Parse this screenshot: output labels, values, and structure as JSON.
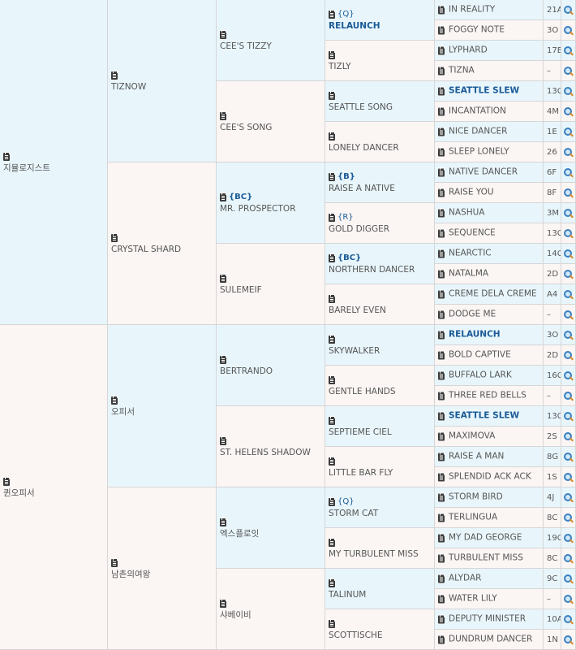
{
  "pedigree": {
    "gen1": [
      {
        "name": "지뮬로지스트",
        "side": "sire"
      },
      {
        "name": "퀸오피서",
        "side": "dam"
      }
    ],
    "gen2": [
      {
        "name": "TIZNOW",
        "side": "sire"
      },
      {
        "name": "CRYSTAL SHARD",
        "side": "dam"
      },
      {
        "name": "오피서",
        "side": "sire"
      },
      {
        "name": "남촌의여왕",
        "side": "dam"
      }
    ],
    "gen3": [
      {
        "name": "CEE'S TIZZY",
        "side": "sire"
      },
      {
        "name": "CEE'S SONG",
        "side": "dam"
      },
      {
        "name": "MR. PROSPECTOR",
        "side": "sire",
        "badge": "{BC}"
      },
      {
        "name": "SULEMEIF",
        "side": "dam"
      },
      {
        "name": "BERTRANDO",
        "side": "sire"
      },
      {
        "name": "ST. HELENS SHADOW",
        "side": "dam"
      },
      {
        "name": "엑스플로잇",
        "side": "sire"
      },
      {
        "name": "샤베이비",
        "side": "dam"
      }
    ],
    "gen4": [
      {
        "name": "RELAUNCH",
        "side": "sire",
        "badge": "{Q}",
        "bold": true
      },
      {
        "name": "TIZLY",
        "side": "dam"
      },
      {
        "name": "SEATTLE SONG",
        "side": "sire"
      },
      {
        "name": "LONELY DANCER",
        "side": "dam"
      },
      {
        "name": "RAISE A NATIVE",
        "side": "sire",
        "badge": "{B}"
      },
      {
        "name": "GOLD DIGGER",
        "side": "dam",
        "badge": "{R}"
      },
      {
        "name": "NORTHERN DANCER",
        "side": "sire",
        "badge": "{BC}"
      },
      {
        "name": "BARELY EVEN",
        "side": "dam"
      },
      {
        "name": "SKYWALKER",
        "side": "sire"
      },
      {
        "name": "GENTLE HANDS",
        "side": "dam"
      },
      {
        "name": "SEPTIEME CIEL",
        "side": "sire"
      },
      {
        "name": "LITTLE BAR FLY",
        "side": "dam"
      },
      {
        "name": "STORM CAT",
        "side": "sire",
        "badge": "{Q}"
      },
      {
        "name": "MY TURBULENT MISS",
        "side": "dam"
      },
      {
        "name": "TALINUM",
        "side": "sire"
      },
      {
        "name": "SCOTTISCHE",
        "side": "dam"
      }
    ],
    "gen5": [
      {
        "name": "IN REALITY",
        "code": "21A",
        "side": "sire"
      },
      {
        "name": "FOGGY NOTE",
        "code": "3O",
        "side": "dam"
      },
      {
        "name": "LYPHARD",
        "code": "17E",
        "side": "sire"
      },
      {
        "name": "TIZNA",
        "code": "–",
        "side": "dam"
      },
      {
        "name": "SEATTLE SLEW",
        "code": "13C",
        "side": "sire",
        "bold": true
      },
      {
        "name": "INCANTATION",
        "code": "4M",
        "side": "dam"
      },
      {
        "name": "NICE DANCER",
        "code": "1E",
        "side": "sire"
      },
      {
        "name": "SLEEP LONELY",
        "code": "26",
        "side": "dam"
      },
      {
        "name": "NATIVE DANCER",
        "code": "6F",
        "side": "sire"
      },
      {
        "name": "RAISE YOU",
        "code": "8F",
        "side": "dam"
      },
      {
        "name": "NASHUA",
        "code": "3M",
        "side": "sire"
      },
      {
        "name": "SEQUENCE",
        "code": "13C",
        "side": "dam"
      },
      {
        "name": "NEARCTIC",
        "code": "14C",
        "side": "sire"
      },
      {
        "name": "NATALMA",
        "code": "2D",
        "side": "dam"
      },
      {
        "name": "CREME DELA CREME",
        "code": "A4",
        "side": "sire"
      },
      {
        "name": "DODGE ME",
        "code": "–",
        "side": "dam"
      },
      {
        "name": "RELAUNCH",
        "code": "3O",
        "side": "sire",
        "bold": true
      },
      {
        "name": "BOLD CAPTIVE",
        "code": "2D",
        "side": "dam"
      },
      {
        "name": "BUFFALO LARK",
        "code": "16C",
        "side": "sire"
      },
      {
        "name": "THREE RED BELLS",
        "code": "–",
        "side": "dam"
      },
      {
        "name": "SEATTLE SLEW",
        "code": "13C",
        "side": "sire",
        "bold": true
      },
      {
        "name": "MAXIMOVA",
        "code": "2S",
        "side": "dam"
      },
      {
        "name": "RAISE A MAN",
        "code": "8G",
        "side": "sire"
      },
      {
        "name": "SPLENDID ACK ACK",
        "code": "1S",
        "side": "dam"
      },
      {
        "name": "STORM BIRD",
        "code": "4J",
        "side": "sire"
      },
      {
        "name": "TERLINGUA",
        "code": "8C",
        "side": "dam"
      },
      {
        "name": "MY DAD GEORGE",
        "code": "19C",
        "side": "sire"
      },
      {
        "name": "TURBULENT MISS",
        "code": "8C",
        "side": "dam"
      },
      {
        "name": "ALYDAR",
        "code": "9C",
        "side": "sire"
      },
      {
        "name": "WATER LILY",
        "code": "–",
        "side": "dam"
      },
      {
        "name": "DEPUTY MINISTER",
        "code": "10A",
        "side": "sire"
      },
      {
        "name": "DUNDRUM DANCER",
        "code": "1N",
        "side": "dam"
      }
    ]
  },
  "colors": {
    "sire_bg": "#e8f6fc",
    "dam_bg": "#fbf5f4",
    "highlight_text": "#1a5a96",
    "text": "#555555"
  },
  "icons": {
    "entry": "clipboard-icon",
    "search": "magnifier-icon"
  }
}
